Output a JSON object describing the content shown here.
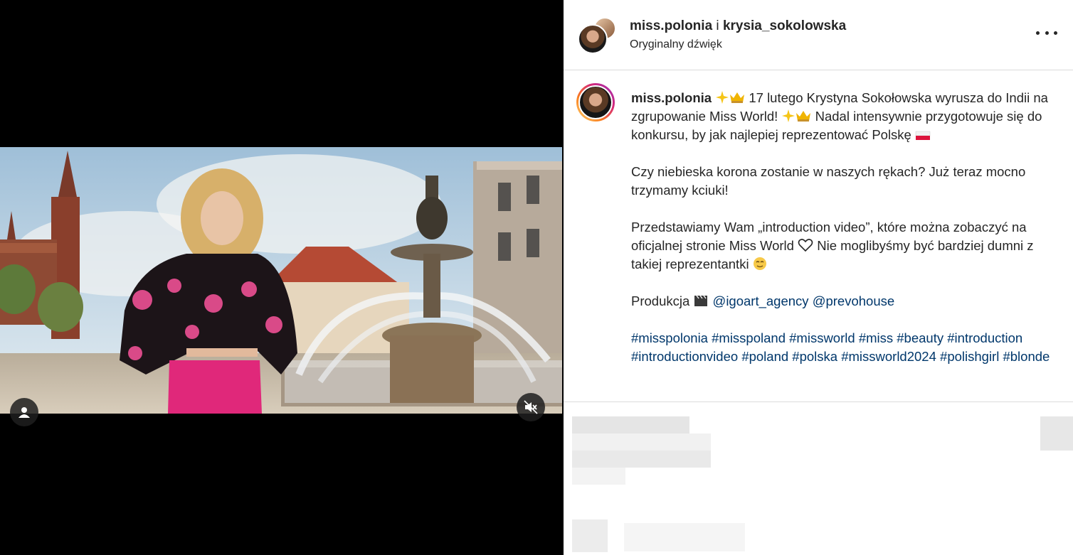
{
  "header": {
    "user_primary": "miss.polonia",
    "joiner": "i",
    "user_secondary": "krysia_sokolowska",
    "audio_label": "Oryginalny dźwięk"
  },
  "caption": {
    "username": "miss.polonia",
    "line1": "17 lutego Krystyna Sokołowska wyrusza do Indii na zgrupowanie Miss World!",
    "line1b": "Nadal intensywnie przygotowuje się do konkursu, by jak najlepiej reprezentować Polskę",
    "paragraph2": "Czy niebieska korona zostanie w naszych rękach? Już teraz mocno trzymamy kciuki!",
    "paragraph3a": "Przedstawiamy Wam „introduction video”, które można zobaczyć na oficjalnej stronie Miss World",
    "paragraph3b": "Nie moglibyśmy być bardziej dumni z takiej reprezentantki",
    "production_label": "Produkcja",
    "mentions": [
      "@igoart_agency",
      "@prevohouse"
    ],
    "hashtags": [
      "#misspolonia",
      "#misspoland",
      "#missworld",
      "#miss",
      "#beauty",
      "#introduction",
      "#introductionvideo",
      "#poland",
      "#polska",
      "#missworld2024",
      "#polishgirl",
      "#blonde"
    ]
  },
  "icons": {
    "sparkles": "sparkles-icon",
    "crown": "crown-icon",
    "flag": "poland-flag-icon",
    "heart": "heart-outline-icon",
    "smile": "relieved-face-icon",
    "clapper": "clapper-board-icon",
    "user_tag": "user-tag-icon",
    "mute": "speaker-muted-icon",
    "more": "more-options-icon"
  },
  "colors": {
    "text": "#262626",
    "link": "#00376b",
    "border": "#dbdbdb"
  }
}
